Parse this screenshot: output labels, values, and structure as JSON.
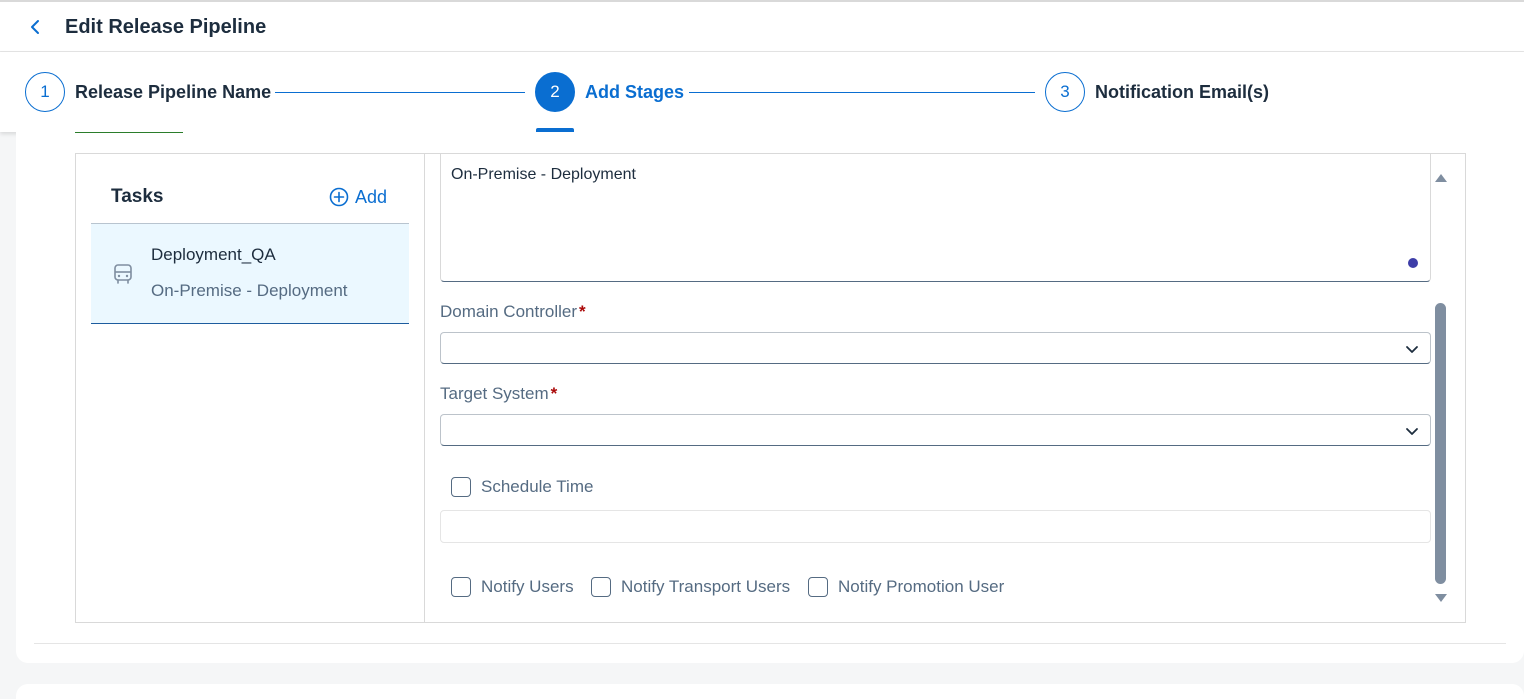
{
  "header": {
    "title": "Edit Release Pipeline",
    "back_icon": "chevron-left-icon"
  },
  "stepper": {
    "steps": [
      {
        "number": "1",
        "label": "Release Pipeline Name",
        "active": false
      },
      {
        "number": "2",
        "label": "Add Stages",
        "active": true
      },
      {
        "number": "3",
        "label": "Notification Email(s)",
        "active": false
      }
    ]
  },
  "tasks": {
    "title": "Tasks",
    "add_label": "Add",
    "add_icon": "add-circle-icon",
    "items": [
      {
        "name": "Deployment_QA",
        "type": "On-Premise - Deployment",
        "icon": "bus-icon",
        "selected": true
      }
    ]
  },
  "form": {
    "description_value": "On-Premise - Deployment",
    "domain_controller": {
      "label": "Domain Controller",
      "required_mark": "*",
      "value": ""
    },
    "target_system": {
      "label": "Target System",
      "required_mark": "*",
      "value": ""
    },
    "schedule_time": {
      "label": "Schedule Time",
      "checked": false,
      "value": ""
    },
    "notify": [
      {
        "label": "Notify Users",
        "checked": false
      },
      {
        "label": "Notify Transport Users",
        "checked": false
      },
      {
        "label": "Notify Promotion User",
        "checked": false
      }
    ]
  },
  "colors": {
    "accent": "#0a6ed1",
    "required": "#aa0808",
    "text": "#1d2d3e",
    "muted": "#556b82",
    "selected_bg": "#ebf8ff"
  }
}
